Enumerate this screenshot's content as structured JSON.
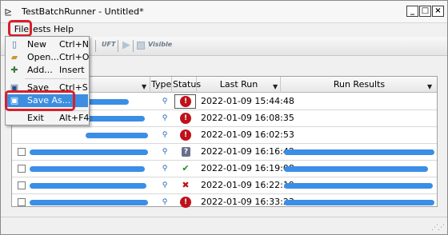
{
  "window": {
    "title": "TestBatchRunner - Untitled*",
    "app_icon": "batch-runner-icon",
    "buttons": {
      "minimize": "_",
      "maximize": "□",
      "close": "×"
    }
  },
  "menubar": {
    "items": [
      "File",
      "Tests",
      "Help"
    ],
    "visible_labels": [
      "File",
      "ests",
      "Help"
    ]
  },
  "toolbar": {
    "uft_label": "UFT",
    "visible_label": "Visible"
  },
  "file_menu": {
    "items": [
      {
        "label": "New",
        "shortcut": "Ctrl+N",
        "icon": "new-file-icon"
      },
      {
        "label": "Open...",
        "shortcut": "Ctrl+O",
        "icon": "open-folder-icon"
      },
      {
        "label": "Add...",
        "shortcut": "Insert",
        "icon": "add-test-icon"
      },
      {
        "label": "Save",
        "shortcut": "Ctrl+S",
        "icon": "save-icon"
      },
      {
        "label": "Save As...",
        "shortcut": "",
        "icon": "save-as-icon",
        "highlighted": true
      },
      {
        "label": "Exit",
        "shortcut": "Alt+F4",
        "icon": ""
      }
    ]
  },
  "grid": {
    "columns": [
      "Type",
      "Status",
      "Last Run",
      "Run Results"
    ],
    "rows": [
      {
        "status": "error",
        "status_glyph": "!",
        "last_run": "2022-01-09 15:44:48",
        "has_results": false
      },
      {
        "status": "error",
        "status_glyph": "!",
        "last_run": "2022-01-09 16:08:35",
        "has_results": false
      },
      {
        "status": "error",
        "status_glyph": "!",
        "last_run": "2022-01-09 16:02:53",
        "has_results": false
      },
      {
        "status": "unknown",
        "status_glyph": "?",
        "last_run": "2022-01-09 16:16:42",
        "has_results": true
      },
      {
        "status": "passed",
        "status_glyph": "✔",
        "last_run": "2022-01-09 16:19:08",
        "has_results": true
      },
      {
        "status": "failed",
        "status_glyph": "✖",
        "last_run": "2022-01-09 16:22:19",
        "has_results": true
      },
      {
        "status": "error",
        "status_glyph": "!",
        "last_run": "2022-01-09 16:33:23",
        "has_results": true
      }
    ]
  },
  "colors": {
    "callout": "#d81e2a",
    "highlight": "#3d8ee0",
    "redaction": "#3a8ee6",
    "error": "#c0111a",
    "passed": "#1f8a1f"
  }
}
